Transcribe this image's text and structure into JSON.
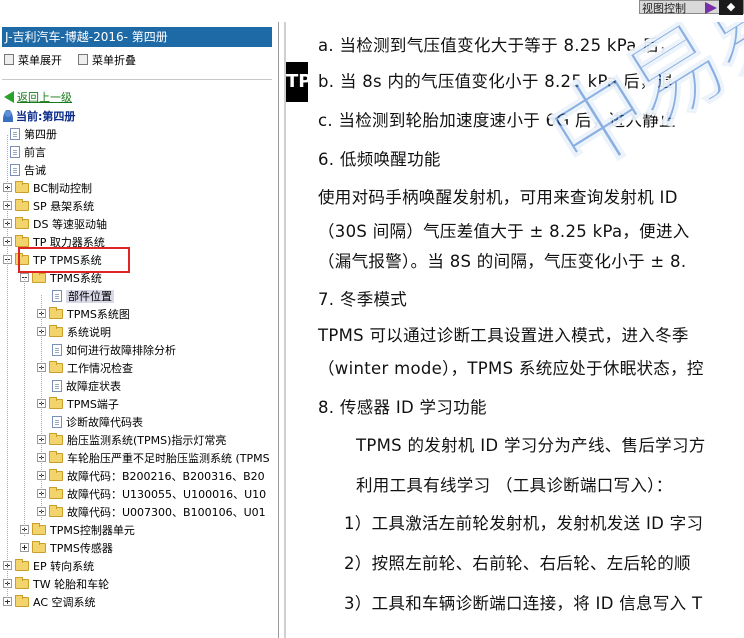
{
  "top": {
    "view_control_label": "视图控制",
    "nav_glyph": "◆"
  },
  "sidebar": {
    "title": "J-吉利汽车-博越-2016- 第四册",
    "expand_label": "菜单展开",
    "collapse_label": "菜单折叠",
    "back_label": "返回上一级",
    "current_label": "当前:第四册",
    "tree": [
      {
        "label": "第四册",
        "type": "doc"
      },
      {
        "label": "前言",
        "type": "doc"
      },
      {
        "label": "告诫",
        "type": "doc"
      },
      {
        "label": "BC制动控制",
        "type": "folder"
      },
      {
        "label": "SP 悬架系统",
        "type": "folder"
      },
      {
        "label": "DS 等速驱动轴",
        "type": "folder"
      },
      {
        "label": "TP 取力器系统",
        "type": "folder"
      },
      {
        "label": "TP TPMS系统",
        "type": "folder-open"
      },
      {
        "label": "TPMS系统",
        "type": "folder-open"
      },
      {
        "label": "部件位置",
        "type": "doc"
      },
      {
        "label": "TPMS系统图",
        "type": "folder"
      },
      {
        "label": "系统说明",
        "type": "folder"
      },
      {
        "label": "如何进行故障排除分析",
        "type": "doc"
      },
      {
        "label": "工作情况检查",
        "type": "folder"
      },
      {
        "label": "故障症状表",
        "type": "doc"
      },
      {
        "label": "TPMS端子",
        "type": "folder"
      },
      {
        "label": "诊断故障代码表",
        "type": "doc"
      },
      {
        "label": "胎压监测系统(TPMS)指示灯常亮",
        "type": "folder"
      },
      {
        "label": "车轮胎压严重不足时胎压监测系统 (TPMS",
        "type": "folder"
      },
      {
        "label": "故障代码：B200216、B200316、B20",
        "type": "folder"
      },
      {
        "label": "故障代码：U130055、U100016、U10",
        "type": "folder"
      },
      {
        "label": "故障代码：U007300、B100106、U01",
        "type": "folder"
      },
      {
        "label": "TPMS控制器单元",
        "type": "folder"
      },
      {
        "label": "TPMS传感器",
        "type": "folder"
      },
      {
        "label": "EP 转向系统",
        "type": "folder"
      },
      {
        "label": "TW 轮胎和车轮",
        "type": "folder"
      },
      {
        "label": "AC 空调系统",
        "type": "folder"
      }
    ]
  },
  "document": {
    "badge": "TP",
    "watermark": "中易易",
    "lines": [
      "a.   当检测到气压值变化大于等于  8.25  kPa  后，",
      "b.   当  8s  内的气压值变化小于 8.25  kPa  后，退",
      "c.   当检测到轮胎加速度速小于  6G  后，进入静止",
      "6.    低频唤醒功能",
      "使用对码手柄唤醒发射机，可用来查询发射机  ID  ",
      "（30S  间隔）气压差值大于  ±  8.25  kPa，便进入",
      "（漏气报警）。当 8S  的间隔，气压变化小于  ±  8.",
      "7.    冬季模式",
      "TPMS  可以通过诊断工具设置进入模式，进入冬季",
      "（winter  mode），TPMS 系统应处于休眠状态，控",
      "8.    传感器 ID 学习功能",
      "TPMS 的发射机 ID 学习分为产线、售后学习方",
      "利用工具有线学习  （工具诊断端口写入）：",
      "1）工具激活左前轮发射机，发射机发送 ID 字习",
      "2）按照左前轮、右前轮、右后轮、左后轮的顺",
      "3）工具和车辆诊断端口连接，将 ID 信息写入 T"
    ]
  }
}
